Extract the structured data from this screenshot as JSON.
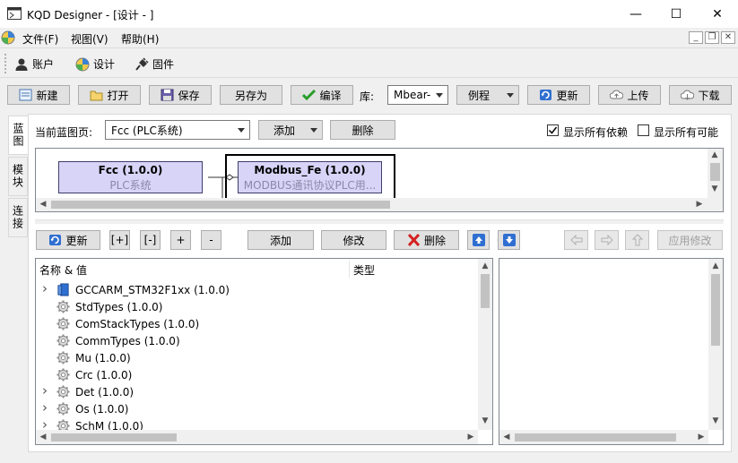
{
  "window": {
    "title": "KQD Designer - [设计 - ]",
    "minimize_glyph": "—",
    "maximize_glyph": "☐",
    "close_glyph": "✕"
  },
  "menubar": {
    "items": [
      "文件(F)",
      "视图(V)",
      "帮助(H)"
    ],
    "mdi_min": "_",
    "mdi_restore": "❐",
    "mdi_close": "✕"
  },
  "toolbar1": {
    "account": "账户",
    "design": "设计",
    "firmware": "固件"
  },
  "toolbar2": {
    "new": "新建",
    "open": "打开",
    "save": "保存",
    "save_as": "另存为",
    "compile": "编译",
    "lib_label": "库:",
    "lib_value": "Mbear-",
    "examples": "例程",
    "update": "更新",
    "upload": "上传",
    "download": "下载"
  },
  "tabs": [
    "蓝图",
    "模块",
    "连接"
  ],
  "blueprint": {
    "page_label": "当前蓝图页:",
    "page_value": "Fcc (PLC系统)",
    "add": "添加",
    "delete": "删除",
    "show_all_deps": "显示所有依赖",
    "show_all_possible": "显示所有可能",
    "show_all_deps_checked": true,
    "show_all_possible_checked": false
  },
  "nodes": [
    {
      "title": "Fcc (1.0.0)",
      "subtitle": "PLC系统"
    },
    {
      "title": "Modbus_Fe (1.0.0)",
      "subtitle": "MODBUS通讯协议PLC用..."
    }
  ],
  "module_toolbar": {
    "update": "更新",
    "expand": "[+]",
    "collapse": "[-]",
    "plus": "+",
    "minus": "-",
    "add": "添加",
    "modify": "修改",
    "delete": "删除",
    "apply": "应用修改"
  },
  "tree": {
    "col_name": "名称 & 值",
    "col_type": "类型",
    "rows": [
      {
        "text": "GCCARM_STM32F1xx (1.0.0)",
        "expandable": true,
        "icon": "chip-icon"
      },
      {
        "text": "StdTypes (1.0.0)",
        "expandable": false,
        "icon": "gear-icon"
      },
      {
        "text": "ComStackTypes (1.0.0)",
        "expandable": false,
        "icon": "gear-icon"
      },
      {
        "text": "CommTypes (1.0.0)",
        "expandable": false,
        "icon": "gear-icon"
      },
      {
        "text": "Mu (1.0.0)",
        "expandable": false,
        "icon": "gear-icon"
      },
      {
        "text": "Crc (1.0.0)",
        "expandable": false,
        "icon": "gear-icon"
      },
      {
        "text": "Det (1.0.0)",
        "expandable": true,
        "icon": "gear-icon"
      },
      {
        "text": "Os (1.0.0)",
        "expandable": true,
        "icon": "gear-icon"
      },
      {
        "text": "SchM (1.0.0)",
        "expandable": true,
        "icon": "gear-icon"
      }
    ]
  },
  "colors": {
    "node_fill": "#d8d4f7",
    "node_border": "#3d3d6b",
    "accent_blue": "#1e6fd0",
    "delete_red": "#d42020",
    "compile_green": "#2a9d2a"
  }
}
